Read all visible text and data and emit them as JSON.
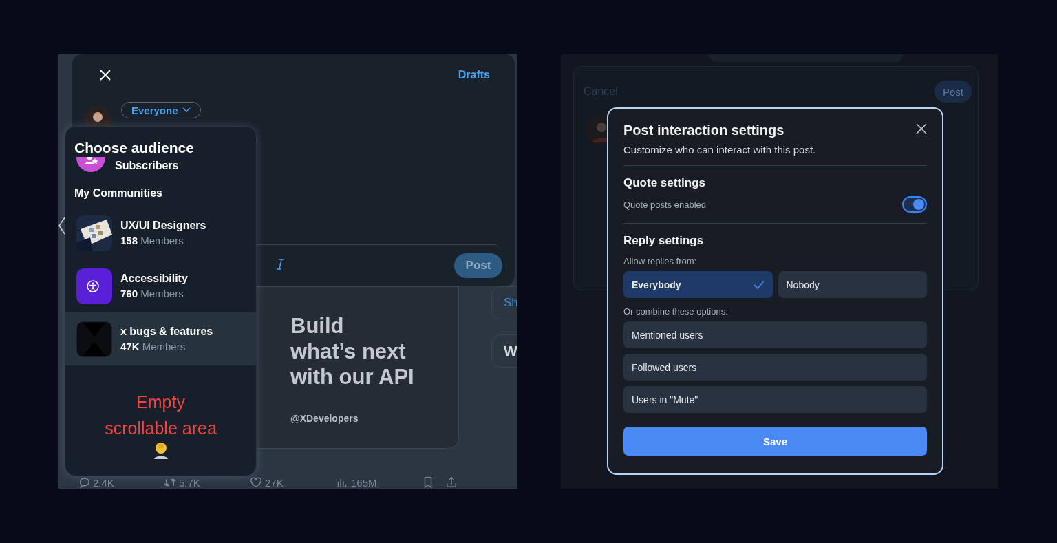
{
  "left": {
    "compose": {
      "drafts": "Drafts",
      "audience": "Everyone",
      "post": "Post"
    },
    "sidebar": [
      {
        "text": "Sh",
        "kind": "link"
      },
      {
        "text": "W",
        "kind": "heading"
      }
    ],
    "feed_card": {
      "headline": [
        "Build",
        "what’s next",
        "with our API"
      ],
      "handle": "@XDevelopers"
    },
    "stats": [
      {
        "kind": "reply",
        "count": "2.4K"
      },
      {
        "kind": "repost",
        "count": "5.7K"
      },
      {
        "kind": "like",
        "count": "27K"
      },
      {
        "kind": "views",
        "count": "165M"
      },
      {
        "kind": "bookmark"
      },
      {
        "kind": "share"
      }
    ],
    "audience_menu": {
      "title": "Choose audience",
      "subscribers": "Subscribers",
      "section": "My Communities",
      "communities": [
        {
          "name": "UX/UI Designers",
          "members": "**158** Members",
          "kind": "picture",
          "highlighted": false
        },
        {
          "name": "Accessibility",
          "members": "**760** Members",
          "kind": "accessibility",
          "highlighted": false
        },
        {
          "name": "x bugs & features",
          "members": "**47K** Members",
          "kind": "dark",
          "highlighted": true
        }
      ],
      "note": [
        "Empty",
        "scrollable area"
      ]
    }
  },
  "right": {
    "background": {
      "cancel": "Cancel",
      "post": "Post"
    },
    "dialog": {
      "title": "Post interaction settings",
      "subtitle": "Customize who can interact with this post.",
      "quote_heading": "Quote settings",
      "quote_label": "Quote posts enabled",
      "quote_on": true,
      "reply_heading": "Reply settings",
      "allow_label": "Allow replies from:",
      "allow": [
        {
          "label": "Everybody",
          "selected": true
        },
        {
          "label": "Nobody",
          "selected": false
        }
      ],
      "combine_label": "Or combine these options:",
      "combine": [
        {
          "label": "Mentioned users",
          "selected": false
        },
        {
          "label": "Followed users",
          "selected": false
        },
        {
          "label": "Users in \"Mute\"",
          "selected": false
        }
      ],
      "save": "Save"
    }
  }
}
